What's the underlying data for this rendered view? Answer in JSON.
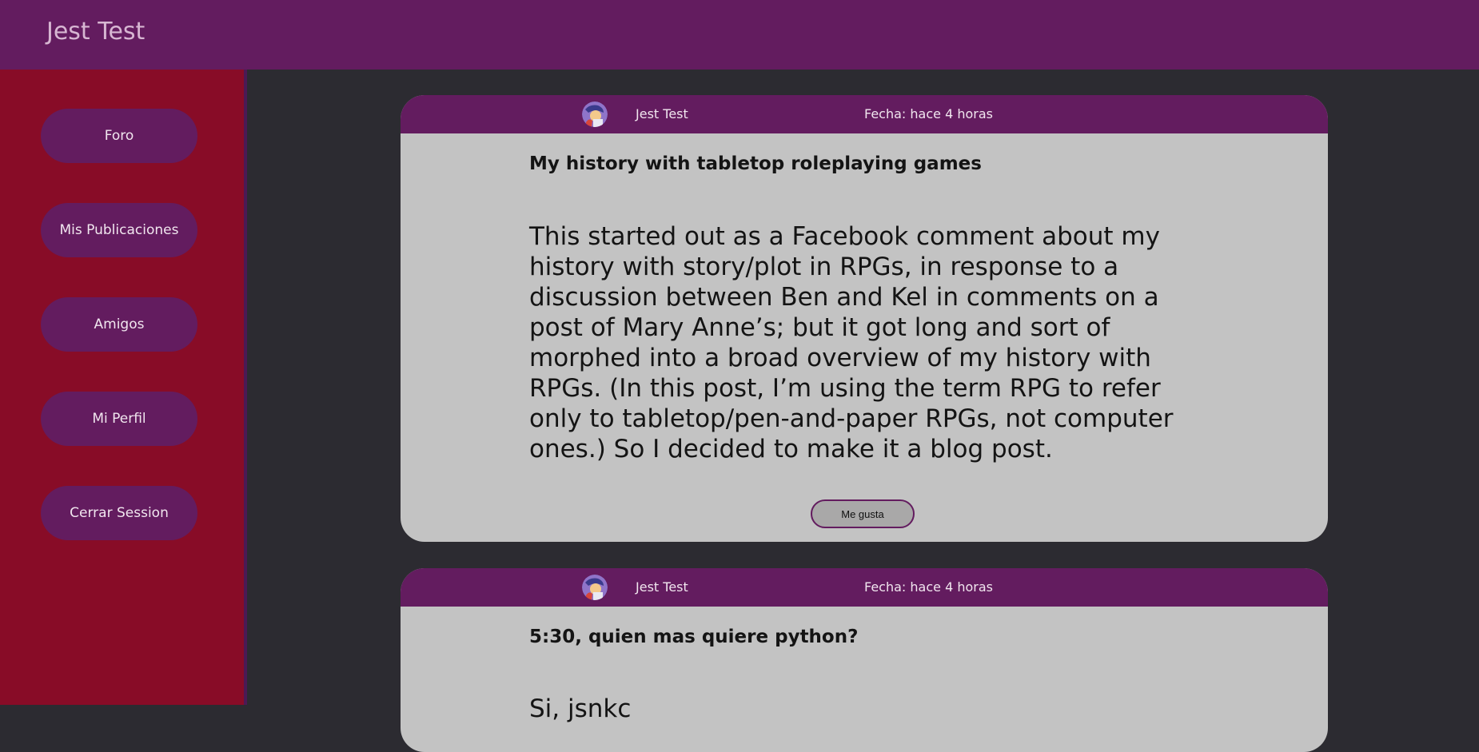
{
  "app": {
    "title": "Jest Test"
  },
  "colors": {
    "header_bg": "#631c5f",
    "sidebar_bg": "#880c27",
    "page_bg": "#2c2b31",
    "card_bg": "#c3c3c3"
  },
  "sidebar": {
    "items": [
      {
        "label": "Foro"
      },
      {
        "label": "Mis Publicaciones"
      },
      {
        "label": "Amigos"
      },
      {
        "label": "Mi Perfil"
      },
      {
        "label": "Cerrar Session"
      }
    ]
  },
  "posts": [
    {
      "author": "Jest Test",
      "avatar_icon": "user-avatar-icon",
      "date": "Fecha: hace 4 horas",
      "title": "My history with tabletop roleplaying games",
      "body": "This started out as a Facebook comment about my history with story/plot in RPGs, in response to a discussion between Ben and Kel in comments on a post of Mary Anne’s; but it got long and sort of morphed into a broad overview of my history with RPGs. (In this post, I’m using the term RPG to refer only to tabletop/pen-and-paper RPGs, not computer ones.) So I decided to make it a blog post.",
      "like_label": "Me gusta"
    },
    {
      "author": "Jest Test",
      "avatar_icon": "user-avatar-icon",
      "date": "Fecha: hace 4 horas",
      "title": "5:30, quien mas quiere python?",
      "body": "Si, jsnkc"
    }
  ]
}
